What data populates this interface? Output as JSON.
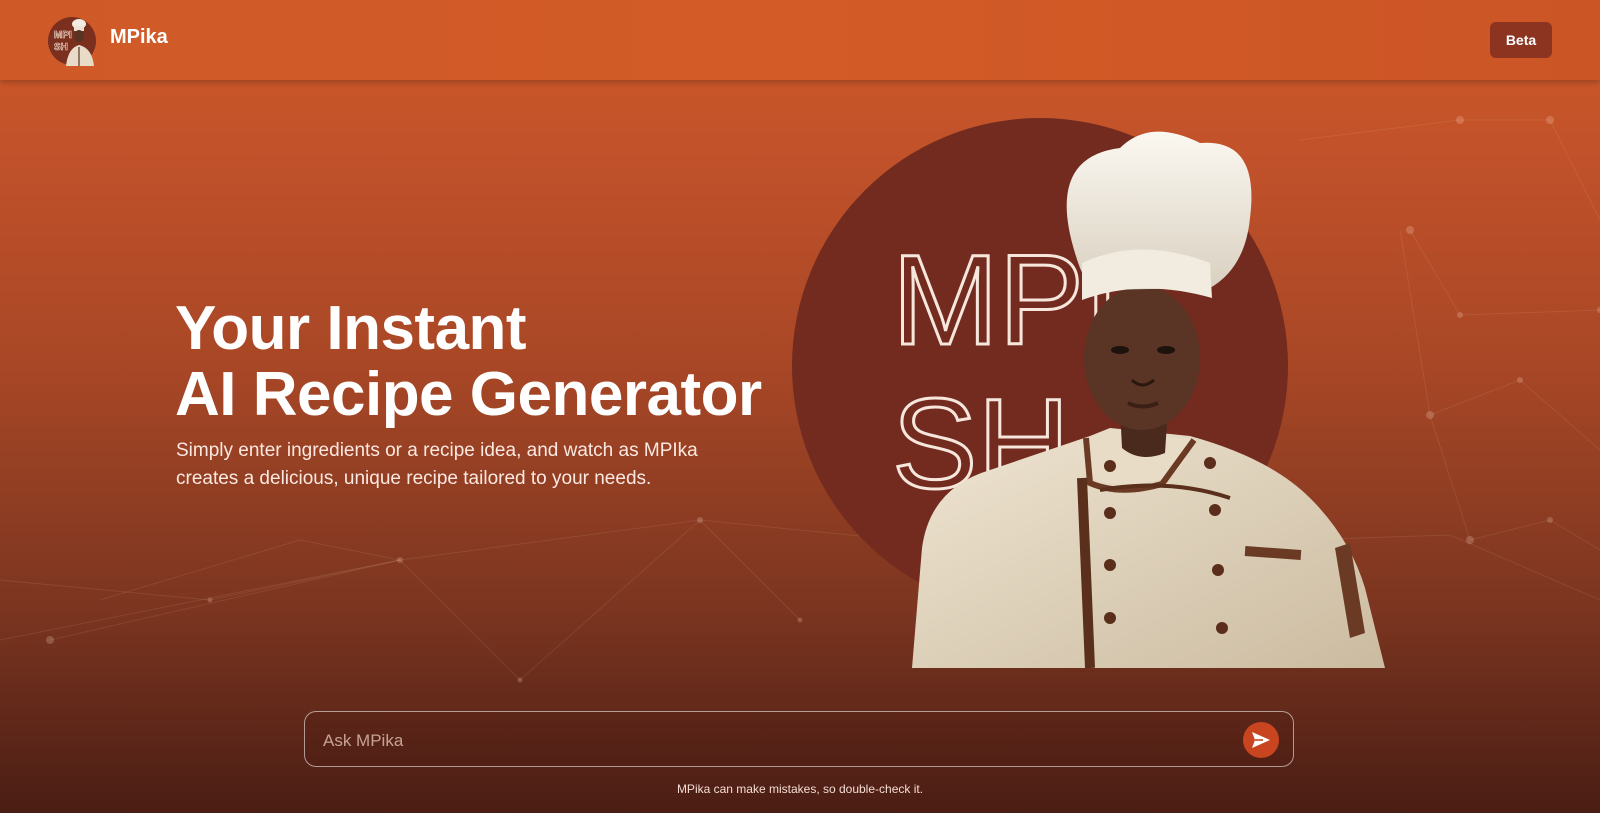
{
  "header": {
    "brand": "MPika",
    "beta_label": "Beta"
  },
  "hero": {
    "title_line1": "Your Instant",
    "title_line2": "AI Recipe Generator",
    "subtitle": "Simply enter ingredients or a recipe idea, and watch as MPIka creates a delicious, unique recipe tailored to your needs."
  },
  "artwork": {
    "outline_line1": "MPI",
    "outline_line2": "SH"
  },
  "chat": {
    "placeholder": "Ask MPika",
    "disclaimer": "MPika can make mistakes, so double-check it."
  },
  "colors": {
    "header": "#d05a28",
    "beta_button": "#8d3420",
    "circle": "#722b1e",
    "send_button": "#c9451f"
  },
  "icons": {
    "send": "send-arrow-icon",
    "logo": "chef-avatar-logo"
  }
}
